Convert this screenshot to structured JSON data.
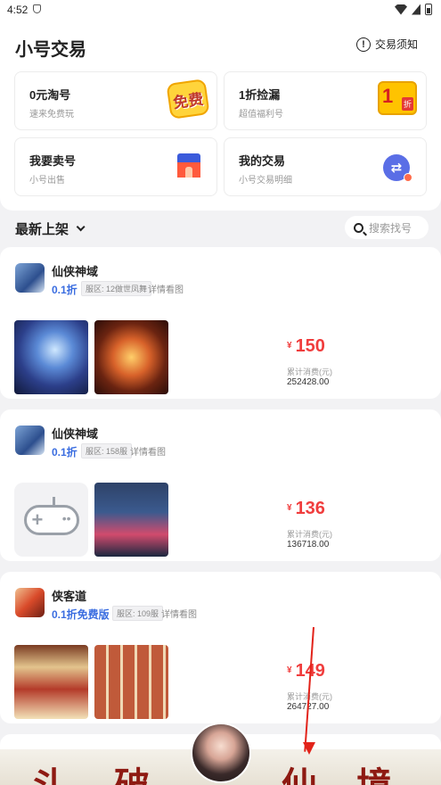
{
  "status_bar": {
    "time": "4:52"
  },
  "header": {
    "title": "小号交易",
    "notice_label": "交易须知"
  },
  "cards": [
    {
      "title": "0元淘号",
      "subtitle": "速来免费玩",
      "badge_text": "免费"
    },
    {
      "title": "1折捡漏",
      "subtitle": "超值福利号",
      "badge_num": "1",
      "badge_tag": "折"
    },
    {
      "title": "我要卖号",
      "subtitle": "小号出售"
    },
    {
      "title": "我的交易",
      "subtitle": "小号交易明细"
    }
  ],
  "section": {
    "title": "最新上架",
    "search_placeholder": "搜索找号"
  },
  "listings": [
    {
      "name": "仙侠神域",
      "discount": "0.1折",
      "server": "服区: 12做世凤舞",
      "detail": "详情看图",
      "price": "150",
      "currency": "¥",
      "spent_label": "累计消费(元)",
      "spent_value": "252428.00"
    },
    {
      "name": "仙侠神域",
      "discount": "0.1折",
      "server": "服区: 158服",
      "detail": "详情看图",
      "price": "136",
      "currency": "¥",
      "spent_label": "累计消费(元)",
      "spent_value": "136718.00"
    },
    {
      "name": "侠客道",
      "discount": "0.1折免费版",
      "server": "服区: 109服",
      "detail": "详情看图",
      "price": "149",
      "currency": "¥",
      "spent_label": "累计消费(元)",
      "spent_value": "264727.00"
    }
  ],
  "banner": {
    "chars": [
      "斗",
      "破",
      "仙",
      "境"
    ]
  },
  "colors": {
    "accent_blue": "#3a6de0",
    "price_red": "#f03d3d",
    "annotation_red": "#e2231a"
  }
}
